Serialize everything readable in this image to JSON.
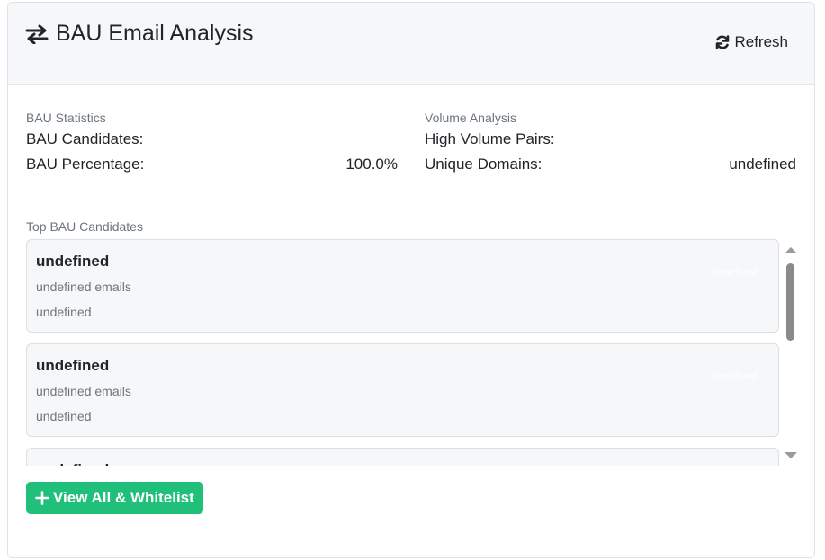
{
  "header": {
    "title": "BAU Email Analysis",
    "title_icon": "exchange-arrows-icon",
    "refresh_label": "Refresh",
    "refresh_icon": "refresh-icon"
  },
  "bau_statistics": {
    "title": "BAU Statistics",
    "rows": [
      {
        "label": "BAU Candidates:",
        "value": ""
      },
      {
        "label": "BAU Percentage:",
        "value": "100.0%"
      }
    ]
  },
  "volume_analysis": {
    "title": "Volume Analysis",
    "rows": [
      {
        "label": "High Volume Pairs:",
        "value": ""
      },
      {
        "label": "Unique Domains:",
        "value": "undefined"
      }
    ]
  },
  "top_candidates": {
    "title": "Top BAU Candidates",
    "items": [
      {
        "name": "undefined",
        "emails": "undefined emails",
        "sub": "undefined",
        "badge": "undefined"
      },
      {
        "name": "undefined",
        "emails": "undefined emails",
        "sub": "undefined",
        "badge": "undefined"
      },
      {
        "name": "undefined",
        "emails": "",
        "sub": "",
        "badge": ""
      }
    ]
  },
  "actions": {
    "view_all_label": "View All & Whitelist",
    "view_all_icon": "plus-icon"
  },
  "colors": {
    "accent_green": "#20c07a",
    "header_bg": "#f6f7f9",
    "muted_text": "#6c757d",
    "text": "#212529"
  }
}
